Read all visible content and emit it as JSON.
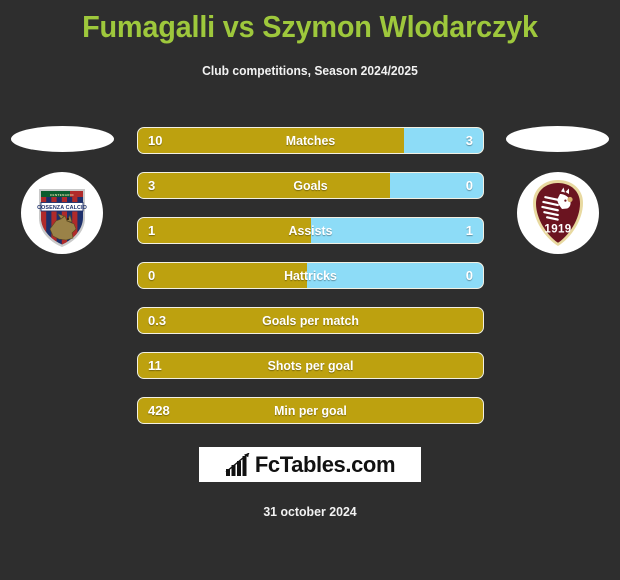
{
  "header": {
    "title": "Fumagalli vs Szymon Wlodarczyk",
    "subtitle": "Club competitions, Season 2024/2025",
    "title_color": "#9ec83c"
  },
  "teams": {
    "home": {
      "badge_name": "cosenza-calcio-badge",
      "badge_text_top": "CENTENARIO",
      "badge_text": "COSENZA CALCIO"
    },
    "away": {
      "badge_name": "salernitana-badge",
      "badge_year": "1919"
    }
  },
  "colors": {
    "home_bar": "#bda10f",
    "away_bar": "#8ddcf7",
    "background": "#2e2e2e",
    "bar_border": "#f3f0e2"
  },
  "chart_data": {
    "type": "bar",
    "title": "Fumagalli vs Szymon Wlodarczyk",
    "subtitle": "Club competitions, Season 2024/2025",
    "orientation": "horizontal-diverging",
    "series": [
      {
        "name": "Fumagalli",
        "color": "#bda10f",
        "values": [
          10,
          3,
          1,
          0,
          0.3,
          11,
          428
        ]
      },
      {
        "name": "Szymon Wlodarczyk",
        "color": "#8ddcf7",
        "values": [
          3,
          0,
          1,
          0,
          null,
          null,
          null
        ]
      }
    ],
    "categories": [
      "Matches",
      "Goals",
      "Assists",
      "Hattricks",
      "Goals per match",
      "Shots per goal",
      "Min per goal"
    ]
  },
  "stats": [
    {
      "label": "Matches",
      "home": "10",
      "away": "3",
      "fill_pct": 77,
      "two_sided": true
    },
    {
      "label": "Goals",
      "home": "3",
      "away": "0",
      "fill_pct": 73,
      "two_sided": true
    },
    {
      "label": "Assists",
      "home": "1",
      "away": "1",
      "fill_pct": 50,
      "two_sided": true
    },
    {
      "label": "Hattricks",
      "home": "0",
      "away": "0",
      "fill_pct": 49,
      "two_sided": true
    },
    {
      "label": "Goals per match",
      "home": "0.3",
      "away": "",
      "fill_pct": 100,
      "two_sided": false
    },
    {
      "label": "Shots per goal",
      "home": "11",
      "away": "",
      "fill_pct": 100,
      "two_sided": false
    },
    {
      "label": "Min per goal",
      "home": "428",
      "away": "",
      "fill_pct": 100,
      "two_sided": false
    }
  ],
  "footer": {
    "logo_text": "FcTables.com",
    "logo_icon": "bar-chart-growth-icon",
    "date": "31 october 2024"
  }
}
